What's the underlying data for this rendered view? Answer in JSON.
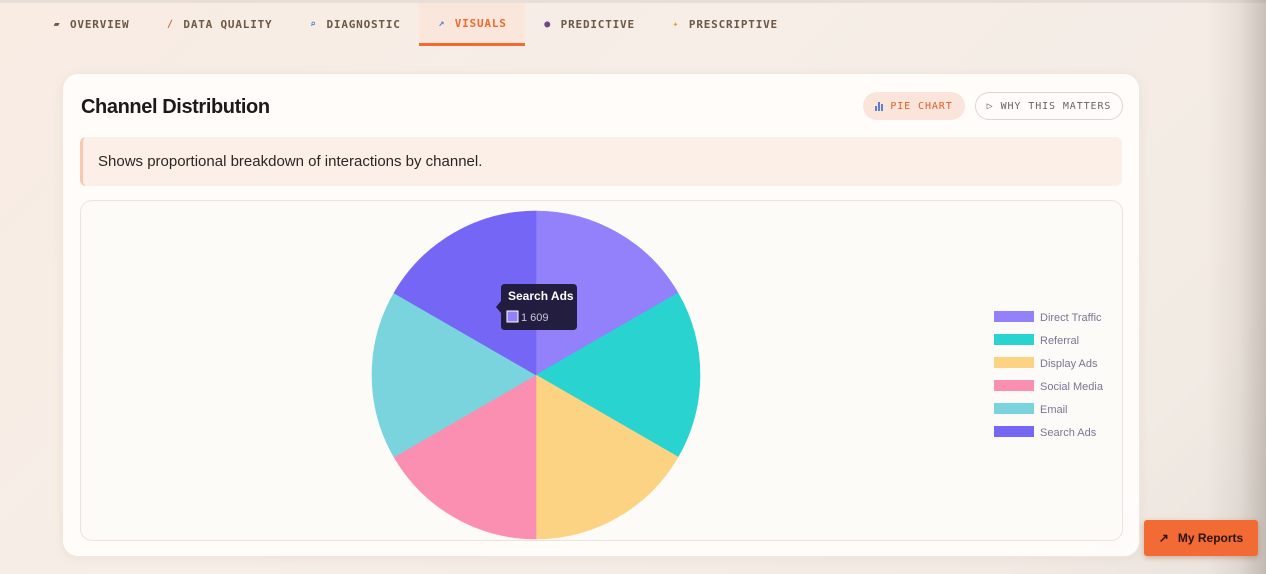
{
  "tabs": [
    {
      "label": "OVERVIEW",
      "icon": "folder-icon",
      "glyph": "▰",
      "active": false
    },
    {
      "label": "DATA QUALITY",
      "icon": "pencil-icon",
      "glyph": "∕",
      "active": false
    },
    {
      "label": "DIAGNOSTIC",
      "icon": "magnifier-icon",
      "glyph": "⌕",
      "active": false
    },
    {
      "label": "VISUALS",
      "icon": "chart-icon",
      "glyph": "↗",
      "active": true
    },
    {
      "label": "PREDICTIVE",
      "icon": "crystal-ball-icon",
      "glyph": "●",
      "active": false
    },
    {
      "label": "PRESCRIPTIVE",
      "icon": "lightbulb-icon",
      "glyph": "✦",
      "active": false
    }
  ],
  "card": {
    "title": "Channel Distribution",
    "chart_type_label": "PIE CHART",
    "why_label": "WHY THIS MATTERS",
    "why_glyph": "▷",
    "description": "Shows proportional breakdown of interactions by channel."
  },
  "tooltip": {
    "title": "Search Ads",
    "value": "1 609"
  },
  "chart_data": {
    "type": "pie",
    "title": "",
    "categories": [
      "Direct Traffic",
      "Referral",
      "Display Ads",
      "Social Media",
      "Email",
      "Search Ads"
    ],
    "values": [
      1609,
      1609,
      1609,
      1609,
      1609,
      1609
    ],
    "colors": [
      "#9281fb",
      "#29d3cf",
      "#fbd383",
      "#fa8fb2",
      "#7ad4de",
      "#7566f6"
    ],
    "legend_position": "right"
  },
  "my_reports": {
    "label": "My Reports",
    "glyph": "↗"
  },
  "colors": {
    "accent": "#f26a2e",
    "tab_active_bg": "#fbe6dc",
    "desc_bg": "#fcefe8"
  }
}
